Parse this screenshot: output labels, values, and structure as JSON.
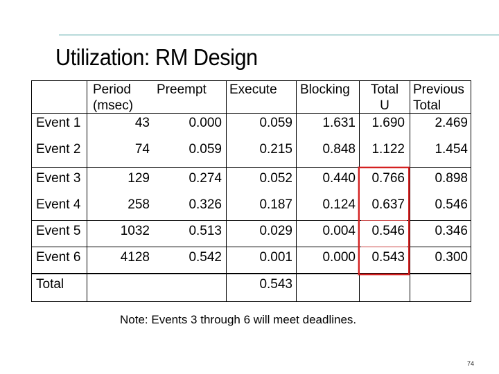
{
  "slide": {
    "title": "Utilization: RM Design",
    "note": "Note: Events 3 through 6 will meet deadlines.",
    "page_number": "74",
    "accent_line_color": "#3a9a9a",
    "highlight_color": "#d42020"
  },
  "table": {
    "headers": {
      "period_line1": "Period",
      "period_line2": "(msec)",
      "preempt": "Preempt",
      "execute": "Execute",
      "blocking": "Blocking",
      "total_u_line1": "Total",
      "total_u_line2": "U",
      "previous_total_line1": "Previous",
      "previous_total_line2": "Total"
    },
    "rows": [
      {
        "event": "Event 1",
        "period": "43",
        "preempt": "0.000",
        "execute": "0.059",
        "blocking": "1.631",
        "total_u": "1.690",
        "previous_total": "2.469"
      },
      {
        "event": "Event 2",
        "period": "74",
        "preempt": "0.059",
        "execute": "0.215",
        "blocking": "0.848",
        "total_u": "1.122",
        "previous_total": "1.454"
      },
      {
        "event": "Event 3",
        "period": "129",
        "preempt": "0.274",
        "execute": "0.052",
        "blocking": "0.440",
        "total_u": "0.766",
        "previous_total": "0.898"
      },
      {
        "event": "Event 4",
        "period": "258",
        "preempt": "0.326",
        "execute": "0.187",
        "blocking": "0.124",
        "total_u": "0.637",
        "previous_total": "0.546"
      },
      {
        "event": "Event 5",
        "period": "1032",
        "preempt": "0.513",
        "execute": "0.029",
        "blocking": "0.004",
        "total_u": "0.546",
        "previous_total": "0.346"
      },
      {
        "event": "Event 6",
        "period": "4128",
        "preempt": "0.542",
        "execute": "0.001",
        "blocking": "0.000",
        "total_u": "0.543",
        "previous_total": "0.300"
      }
    ],
    "total_row": {
      "label": "Total",
      "execute": "0.543"
    },
    "highlighted_rows": [
      "Event 3",
      "Event 4",
      "Event 5",
      "Event 6"
    ],
    "highlighted_column": "Total U"
  }
}
